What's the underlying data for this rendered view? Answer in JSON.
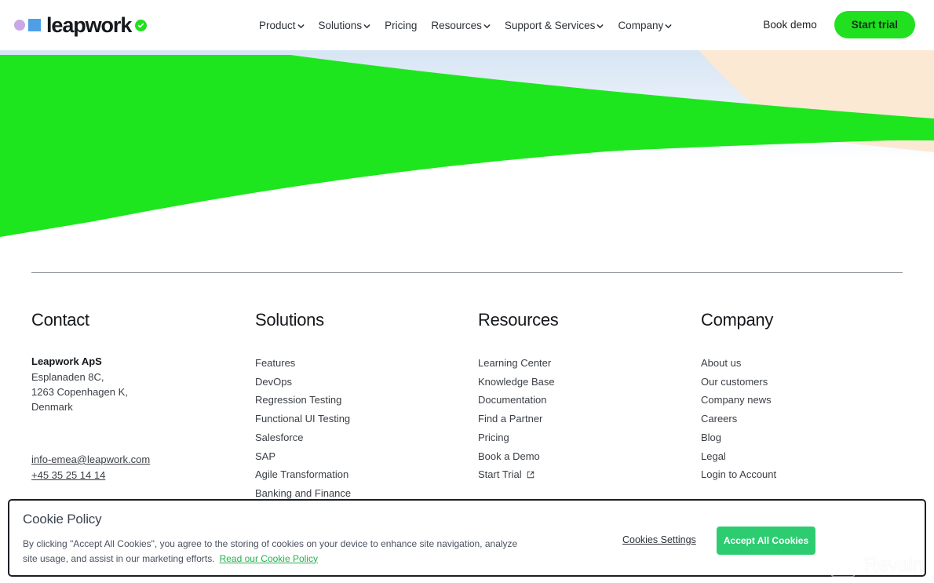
{
  "header": {
    "logo": {
      "text": "leapwork",
      "dot_color": "#c9a8e8",
      "square_color": "#4e9ee8",
      "check_color": "#20e020"
    },
    "nav": [
      {
        "label": "Product",
        "has_caret": true
      },
      {
        "label": "Solutions",
        "has_caret": true
      },
      {
        "label": "Pricing",
        "has_caret": false
      },
      {
        "label": "Resources",
        "has_caret": true
      },
      {
        "label": "Support & Services",
        "has_caret": true
      },
      {
        "label": "Company",
        "has_caret": true
      }
    ],
    "book_demo_label": "Book demo",
    "start_trial_label": "Start trial",
    "start_trial_color": "#20e020"
  },
  "hero": {
    "green_color": "#1ee61e",
    "blue_color": "#dce8f5",
    "peach_color": "#fce9d4"
  },
  "footer": {
    "contact": {
      "title": "Contact",
      "company": "Leapwork ApS",
      "address_lines": [
        "Esplanaden 8C,",
        "1263 Copenhagen K,",
        "Denmark"
      ],
      "email": "info-emea@leapwork.com",
      "phone": "+45 35 25 14 14"
    },
    "solutions": {
      "title": "Solutions",
      "links": [
        "Features",
        "DevOps",
        "Regression Testing",
        "Functional UI Testing",
        "Salesforce",
        "SAP",
        "Agile Transformation",
        "Banking and Finance"
      ]
    },
    "resources": {
      "title": "Resources",
      "links": [
        "Learning Center",
        "Knowledge Base",
        "Documentation",
        "Find a Partner",
        "Pricing",
        "Book a Demo"
      ],
      "external_link": "Start Trial"
    },
    "company": {
      "title": "Company",
      "links": [
        "About us",
        "Our customers",
        "Company news",
        "Careers",
        "Blog",
        "Legal",
        "Login to Account"
      ]
    }
  },
  "cookie_banner": {
    "title": "Cookie Policy",
    "body": "By clicking \"Accept All Cookies\", you agree to the storing of cookies on your device to enhance site navigation, analyze site usage, and assist in our marketing efforts.",
    "policy_link": "Read our Cookie Policy",
    "settings_label": "Cookies Settings",
    "accept_label": "Accept All Cookies",
    "accept_color": "#2ecc71",
    "link_color": "#22b24c"
  },
  "watermark": {
    "text": "Revain"
  }
}
